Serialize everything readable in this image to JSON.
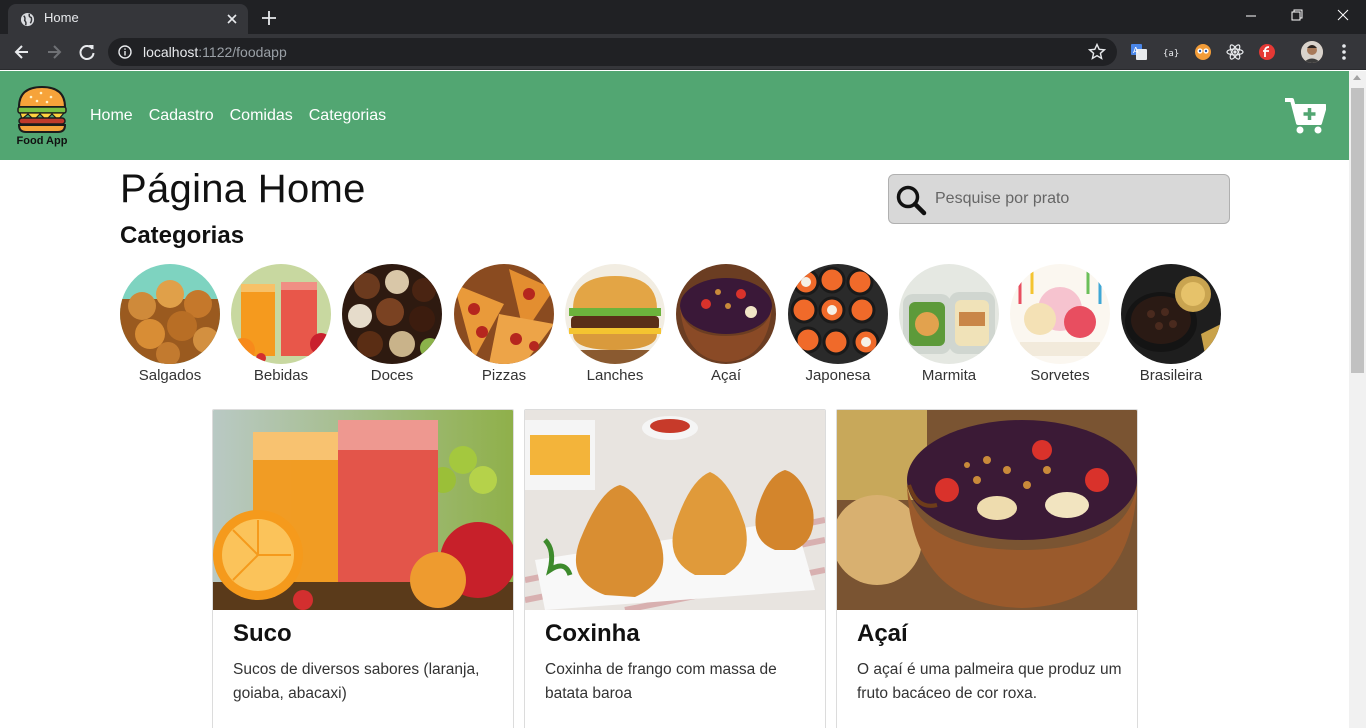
{
  "browser": {
    "tab_title": "Home",
    "url_host": "localhost",
    "url_rest": ":1122/foodapp"
  },
  "nav": {
    "logo_text": "Food App",
    "links": [
      "Home",
      "Cadastro",
      "Comidas",
      "Categorias"
    ],
    "brand_color": "#52a672"
  },
  "page": {
    "title": "Página Home",
    "categories_heading": "Categorias",
    "search_placeholder": "Pesquise por prato"
  },
  "categories": [
    {
      "label": "Salgados"
    },
    {
      "label": "Bebidas"
    },
    {
      "label": "Doces"
    },
    {
      "label": "Pizzas"
    },
    {
      "label": "Lanches"
    },
    {
      "label": "Açaí"
    },
    {
      "label": "Japonesa"
    },
    {
      "label": "Marmita"
    },
    {
      "label": "Sorvetes"
    },
    {
      "label": "Brasileira"
    }
  ],
  "cards": [
    {
      "title": "Suco",
      "text": "Sucos de diversos sabores (laranja, goiaba, abacaxi)"
    },
    {
      "title": "Coxinha",
      "text": "Coxinha de frango com massa de batata baroa"
    },
    {
      "title": "Açaí",
      "text": "O açaí é uma palmeira que produz um fruto bacáceo de cor roxa."
    }
  ]
}
